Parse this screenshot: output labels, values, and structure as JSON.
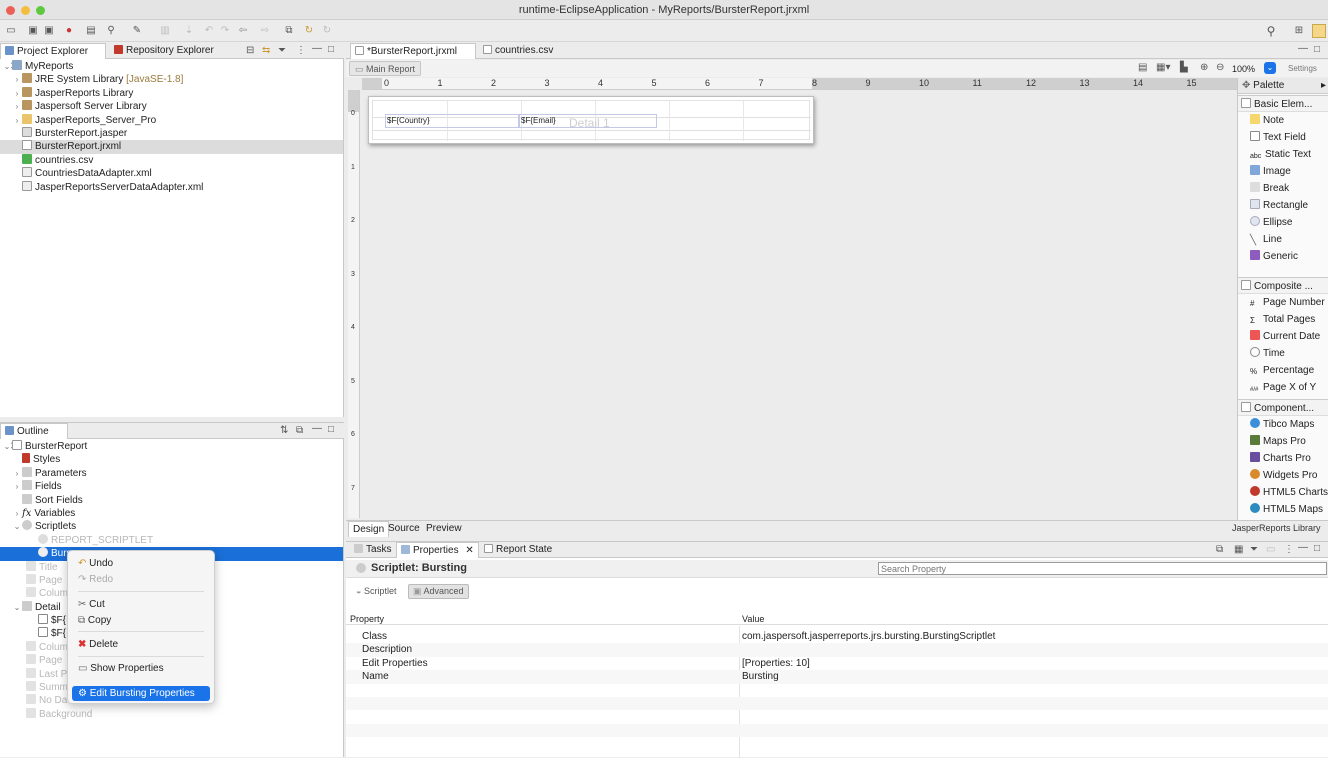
{
  "window": {
    "title": "runtime-EclipseApplication - MyReports/BursterReport.jrxml"
  },
  "project_explorer": {
    "tab_label": "Project Explorer",
    "other_tab": "Repository Explorer",
    "items": [
      {
        "label": "MyReports",
        "suffix": ""
      },
      {
        "label": "JRE System Library",
        "suffix": "[JavaSE-1.8]"
      },
      {
        "label": "JasperReports Library",
        "suffix": ""
      },
      {
        "label": "Jaspersoft Server Library",
        "suffix": ""
      },
      {
        "label": "JasperReports_Server_Pro",
        "suffix": ""
      },
      {
        "label": "BursterReport.jasper",
        "suffix": ""
      },
      {
        "label": "BursterReport.jrxml",
        "suffix": ""
      },
      {
        "label": "countries.csv",
        "suffix": ""
      },
      {
        "label": "CountriesDataAdapter.xml",
        "suffix": ""
      },
      {
        "label": "JasperReportsServerDataAdapter.xml",
        "suffix": ""
      }
    ]
  },
  "outline": {
    "tab_label": "Outline",
    "items": [
      {
        "label": "BursterReport"
      },
      {
        "label": "Styles"
      },
      {
        "label": "Parameters"
      },
      {
        "label": "Fields"
      },
      {
        "label": "Sort Fields"
      },
      {
        "label": "Variables"
      },
      {
        "label": "Scriptlets"
      },
      {
        "label": "REPORT_SCRIPTLET"
      },
      {
        "label": "Burs"
      },
      {
        "label": "Title"
      },
      {
        "label": "Page"
      },
      {
        "label": "Colum"
      },
      {
        "label": "Detail"
      },
      {
        "label": "$F{"
      },
      {
        "label": "$F{"
      },
      {
        "label": "Colum"
      },
      {
        "label": "Page"
      },
      {
        "label": "Last P"
      },
      {
        "label": "Summ"
      },
      {
        "label": "No Da"
      },
      {
        "label": "Background"
      }
    ]
  },
  "editor": {
    "tabs": [
      {
        "label": "*BursterReport.jrxml"
      },
      {
        "label": "countries.csv"
      }
    ],
    "main_report_btn": "Main Report",
    "zoom": "100%",
    "settings": "Settings",
    "ruler_h": [
      "0",
      "1",
      "2",
      "3",
      "4",
      "5",
      "6",
      "7",
      "8",
      "9",
      "10",
      "11",
      "12",
      "13",
      "14",
      "15"
    ],
    "ruler_v": [
      "0",
      "1",
      "2",
      "3",
      "4",
      "5",
      "6",
      "7"
    ],
    "band_label": "Detail 1",
    "field1": "$F{Country}",
    "field2": "$F{Email}",
    "bottom_tabs": [
      "Design",
      "Source",
      "Preview"
    ],
    "library_label": "JasperReports Library"
  },
  "palette": {
    "title": "Palette",
    "sections": [
      {
        "title": "Basic Elem...",
        "items": [
          "Note",
          "Text Field",
          "Static Text",
          "Image",
          "Break",
          "Rectangle",
          "Ellipse",
          "Line",
          "Generic"
        ]
      },
      {
        "title": "Composite ...",
        "items": [
          "Page Number",
          "Total Pages",
          "Current Date",
          "Time",
          "Percentage",
          "Page X of Y"
        ]
      },
      {
        "title": "Component...",
        "items": [
          "Tibco Maps",
          "Maps Pro",
          "Charts Pro",
          "Widgets Pro",
          "HTML5 Charts",
          "HTML5 Maps"
        ]
      }
    ]
  },
  "properties": {
    "tabs": [
      "Tasks",
      "Properties",
      "Report State"
    ],
    "title": "Scriptlet: Bursting",
    "search_placeholder": "Search Property",
    "subtabs": [
      "Scriptlet",
      "Advanced"
    ],
    "col_property": "Property",
    "col_value": "Value",
    "rows": [
      {
        "name": "Class",
        "value": "com.jaspersoft.jasperreports.jrs.bursting.BurstingScriptlet"
      },
      {
        "name": "Description",
        "value": ""
      },
      {
        "name": "Edit Properties",
        "value": "[Properties: 10]"
      },
      {
        "name": "Name",
        "value": "Bursting"
      }
    ]
  },
  "context_menu": {
    "items": [
      {
        "label": "Undo",
        "enabled": true
      },
      {
        "label": "Redo",
        "enabled": false
      },
      {
        "label": "Cut",
        "enabled": true
      },
      {
        "label": "Copy",
        "enabled": true
      },
      {
        "label": "Delete",
        "enabled": true
      },
      {
        "label": "Show Properties",
        "enabled": true
      },
      {
        "label": "Edit Bursting Properties",
        "enabled": true
      }
    ]
  },
  "colors": {
    "selection": "#1a6fd8",
    "accent": "#1a73e8"
  }
}
